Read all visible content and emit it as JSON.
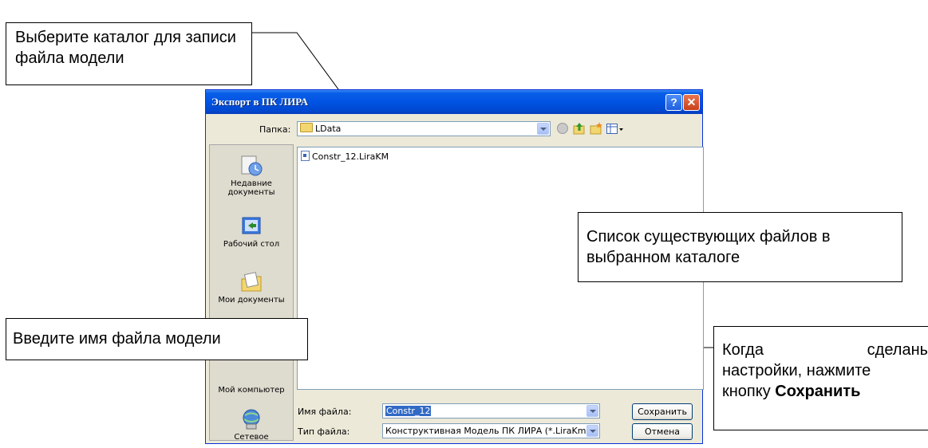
{
  "dialog": {
    "title": "Экспорт в ПК ЛИРА",
    "help_label": "?",
    "close_label": "✕",
    "folder_label": "Папка:",
    "folder_value": "LData",
    "files": [
      "Constr_12.LiraKM"
    ],
    "places": [
      {
        "label": "Недавние документы",
        "icon": "recent-documents-icon"
      },
      {
        "label": "Рабочий стол",
        "icon": "desktop-icon"
      },
      {
        "label": "Мои документы",
        "icon": "my-documents-icon"
      },
      {
        "label": "Мой компьютер",
        "icon": "my-computer-icon"
      },
      {
        "label": "Сетевое",
        "icon": "network-icon"
      }
    ],
    "filename_label": "Имя файла:",
    "filename_value": "Constr_12",
    "filetype_label": "Тип файла:",
    "filetype_value": "Конструктивная Модель ПК ЛИРА (*.LiraKm)",
    "save_button": "Сохранить",
    "cancel_button": "Отмена"
  },
  "callouts": {
    "folder": "Выберите каталог для записи файла модели",
    "files": "Список существующих файлов в выбранном каталоге",
    "filename": "Введите имя файла модели",
    "save_line1": "Когда сделаны",
    "save_line2": "настройки, нажмите",
    "save_line3_prefix": "кнопку ",
    "save_line3_bold": "Сохранить"
  },
  "colors": {
    "titlebar": "#0054e3",
    "dialog_bg": "#ece9d8",
    "selection": "#316ac5"
  }
}
